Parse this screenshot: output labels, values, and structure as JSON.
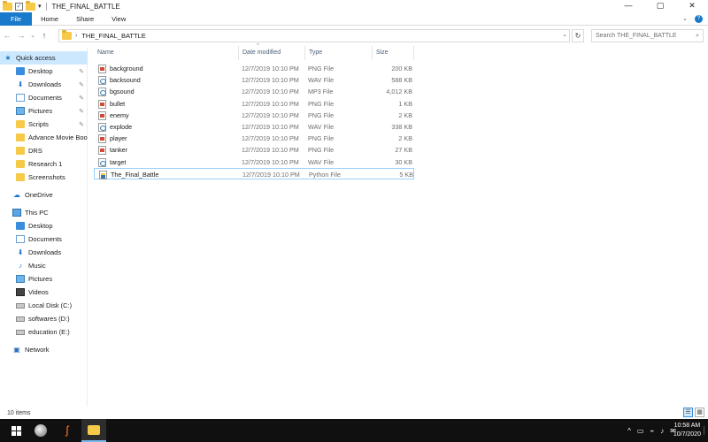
{
  "window": {
    "title": "THE_FINAL_BATTLE",
    "quick_access_dropdown": "▾",
    "controls": {
      "minimize": "—",
      "maximize": "▢",
      "close": "✕"
    }
  },
  "ribbon": {
    "tabs": [
      "File",
      "Home",
      "Share",
      "View"
    ],
    "expand": "⌄",
    "help": "?"
  },
  "address_bar": {
    "back": "←",
    "forward": "→",
    "recent": "⌄",
    "up": "↑",
    "chevron": "›",
    "path": "THE_FINAL_BATTLE",
    "dropdown": "⌄",
    "refresh": "↻"
  },
  "search": {
    "placeholder": "Search THE_FINAL_BATTLE",
    "icon": "⌕"
  },
  "nav": {
    "quick_access": "Quick access",
    "quick_items": [
      {
        "label": "Desktop",
        "icon": "desktop-icon",
        "pinned": true
      },
      {
        "label": "Downloads",
        "icon": "downloads-icon",
        "pinned": true
      },
      {
        "label": "Documents",
        "icon": "documents-icon",
        "pinned": true
      },
      {
        "label": "Pictures",
        "icon": "pictures-icon",
        "pinned": true
      },
      {
        "label": "Scripts",
        "icon": "folder-icon",
        "pinned": true
      },
      {
        "label": "Advance Movie Boo",
        "icon": "folder-icon",
        "pinned": false
      },
      {
        "label": "DRS",
        "icon": "folder-icon",
        "pinned": false
      },
      {
        "label": "Research 1",
        "icon": "folder-icon",
        "pinned": false
      },
      {
        "label": "Screenshots",
        "icon": "folder-icon",
        "pinned": false
      }
    ],
    "onedrive": "OneDrive",
    "this_pc": "This PC",
    "pc_items": [
      {
        "label": "Desktop",
        "icon": "desktop-icon"
      },
      {
        "label": "Documents",
        "icon": "documents-icon"
      },
      {
        "label": "Downloads",
        "icon": "downloads-icon"
      },
      {
        "label": "Music",
        "icon": "music-icon"
      },
      {
        "label": "Pictures",
        "icon": "pictures-icon"
      },
      {
        "label": "Videos",
        "icon": "videos-icon"
      },
      {
        "label": "Local Disk (C:)",
        "icon": "disk-icon"
      },
      {
        "label": "softwares (D:)",
        "icon": "disk-icon"
      },
      {
        "label": "education (E:)",
        "icon": "disk-icon"
      }
    ],
    "network": "Network"
  },
  "columns": {
    "name": "Name",
    "date": "Date modified",
    "type": "Type",
    "size": "Size",
    "sort_indicator": "^"
  },
  "files": [
    {
      "name": "background",
      "date": "12/7/2019 10:10 PM",
      "type": "PNG File",
      "size": "200 KB",
      "kind": "png"
    },
    {
      "name": "backsound",
      "date": "12/7/2019 10:10 PM",
      "type": "WAV File",
      "size": "588 KB",
      "kind": "wav"
    },
    {
      "name": "bgsound",
      "date": "12/7/2019 10:10 PM",
      "type": "MP3 File",
      "size": "4,012 KB",
      "kind": "mp3"
    },
    {
      "name": "bullet",
      "date": "12/7/2019 10:10 PM",
      "type": "PNG File",
      "size": "1 KB",
      "kind": "png"
    },
    {
      "name": "enemy",
      "date": "12/7/2019 10:10 PM",
      "type": "PNG File",
      "size": "2 KB",
      "kind": "png"
    },
    {
      "name": "explode",
      "date": "12/7/2019 10:10 PM",
      "type": "WAV File",
      "size": "338 KB",
      "kind": "wav"
    },
    {
      "name": "player",
      "date": "12/7/2019 10:10 PM",
      "type": "PNG File",
      "size": "2 KB",
      "kind": "png"
    },
    {
      "name": "tanker",
      "date": "12/7/2019 10:10 PM",
      "type": "PNG File",
      "size": "27 KB",
      "kind": "png"
    },
    {
      "name": "target",
      "date": "12/7/2019 10:10 PM",
      "type": "WAV File",
      "size": "30 KB",
      "kind": "wav"
    },
    {
      "name": "The_Final_Battle",
      "date": "12/7/2019 10:10 PM",
      "type": "Python File",
      "size": "5 KB",
      "kind": "py"
    }
  ],
  "status": {
    "item_count": "10 items",
    "details_view": "☰",
    "tiles_view": "▦"
  },
  "taskbar": {
    "apps": [
      "start-icon",
      "browser-icon",
      "sublime-icon",
      "file-explorer-icon"
    ],
    "tray_icons": [
      "^",
      "▭",
      "⌁",
      "♪",
      "✉"
    ],
    "time": "10:58 AM",
    "date": "10/7/2020"
  }
}
